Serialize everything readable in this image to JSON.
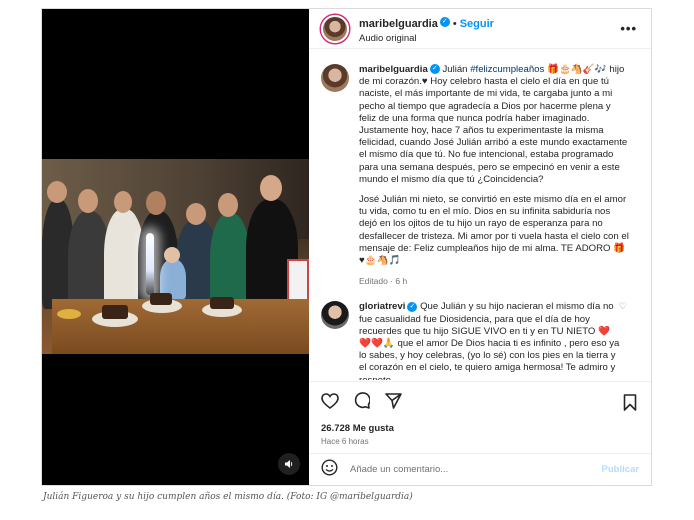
{
  "post": {
    "username": "maribelguardia",
    "follow_label": "Seguir",
    "separator": "•",
    "audio": "Audio original",
    "more": "•••",
    "icons": {
      "verified": "check",
      "sound": "speaker-icon",
      "like": "heart-icon",
      "comment": "bubble-icon",
      "share": "paper-plane-icon",
      "save": "bookmark-icon",
      "emoji": "smiley-icon"
    }
  },
  "caption_comment": {
    "username": "maribelguardia",
    "line1_after_user": "Julián ",
    "hashtag": "#felizcumpleaños",
    "line1_emojis": " 🎁🎂🐴🎸🎶 hijo",
    "p1_rest": "de mi corazón.♥ Hoy celebro hasta el cielo el día en que tú naciste, el más importante de mi vida, te cargaba junto a mi pecho al tiempo que agradecía a Dios por hacerme plena y feliz de una forma que nunca podría haber imaginado.",
    "p1b": "Justamente hoy, hace 7 años tu experimentaste la misma felicidad, cuando José Julián arribó a este mundo exactamente el mismo día que tú. No fue intencional, estaba programado para una semana después, pero se empecinó en venir a este mundo el mismo día que tú ¿Coincidencia?",
    "p2": "José Julián mi nieto, se convirtió en este mismo día en el amor tu vida, como tu en el mío. Dios en su infinita sabiduría nos dejó en los ojitos de tu hijo un rayo de esperanza para no desfallecer de tristeza. Mi amor por ti vuela hasta el cielo con el mensaje de: Feliz cumpleaños hijo de mi alma. TE ADORO 🎁♥🎂🐴🎵",
    "meta": "Editado · 6 h"
  },
  "reply_comment": {
    "username": "gloriatrevi",
    "text": "Que Julián y su hijo nacieran el mismo día no fue casualidad fue Diosidencia, para que el día de hoy recuerdes que tu hijo SIGUE VIVO en ti y en TU NIETO ❤️❤️❤️🙏 que el amor De Dios hacia ti es infinito , pero eso ya lo sabes, y hoy celebras, (yo lo sé) con los pies en la tierra y el corazón en el cielo, te quiero amiga hermosa! Te admiro y respeto",
    "like_icon": "small-heart-icon"
  },
  "stats": {
    "likes": "26.728 Me gusta",
    "time": "Hace 6 horas"
  },
  "composer": {
    "placeholder": "Añade un comentario...",
    "publish": "Publicar"
  },
  "photo_caption": "Julián Figueroa y su hijo cumplen años el mismo día. (Foto: IG @maribelguardia)"
}
